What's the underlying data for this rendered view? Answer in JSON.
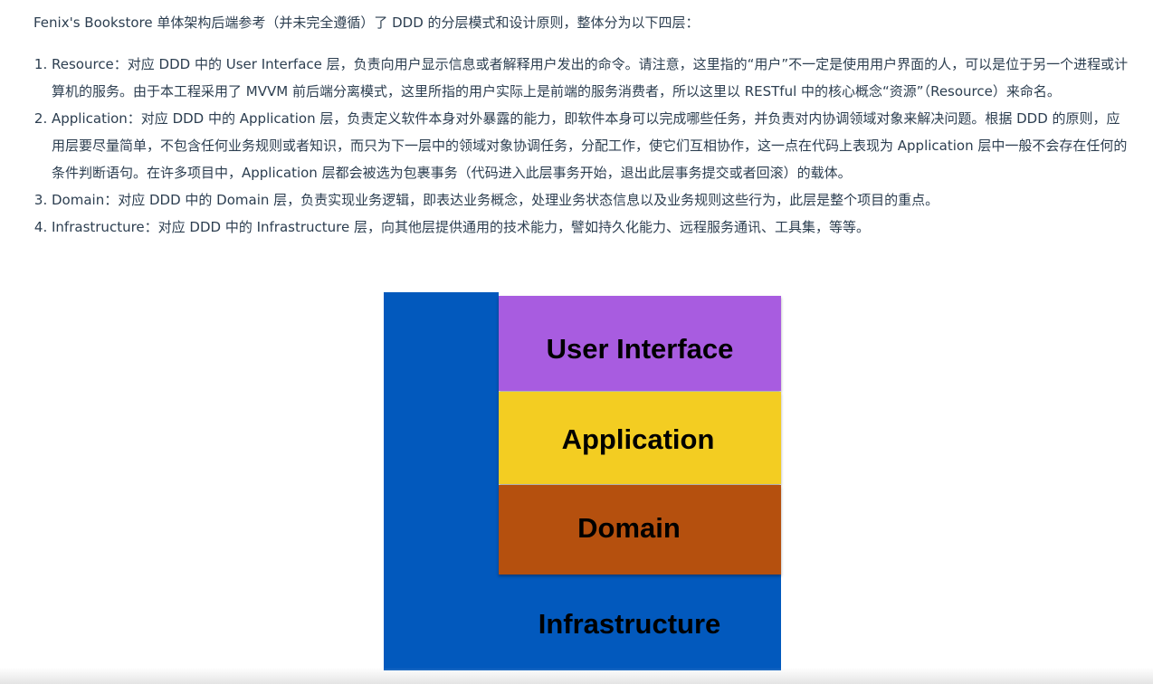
{
  "article": {
    "intro": "Fenix's Bookstore 单体架构后端参考（并未完全遵循）了 DDD 的分层模式和设计原则，整体分为以下四层：",
    "list": [
      "Resource：对应 DDD 中的 User Interface 层，负责向用户显示信息或者解释用户发出的命令。请注意，这里指的“用户”不一定是使用用户界面的人，可以是位于另一个进程或计算机的服务。由于本工程采用了 MVVM 前后端分离模式，这里所指的用户实际上是前端的服务消费者，所以这里以 RESTful 中的核心概念“资源”（Resource）来命名。",
      "Application：对应 DDD 中的 Application 层，负责定义软件本身对外暴露的能力，即软件本身可以完成哪些任务，并负责对内协调领域对象来解决问题。根据 DDD 的原则，应用层要尽量简单，不包含任何业务规则或者知识，而只为下一层中的领域对象协调任务，分配工作，使它们互相协作，这一点在代码上表现为 Application 层中一般不会存在任何的条件判断语句。在许多项目中，Application 层都会被选为包裹事务（代码进入此层事务开始，退出此层事务提交或者回滚）的载体。",
      "Domain：对应 DDD 中的 Domain 层，负责实现业务逻辑，即表达业务概念，处理业务状态信息以及业务规则这些行为，此层是整个项目的重点。",
      "Infrastructure：对应 DDD 中的 Infrastructure 层，向其他层提供通用的技术能力，譬如持久化能力、远程服务通讯、工具集，等等。"
    ]
  },
  "diagram": {
    "layers": {
      "ui": "User Interface",
      "application": "Application",
      "domain": "Domain",
      "infrastructure": "Infrastructure"
    },
    "colors": {
      "ui": "#a85ce0",
      "application": "#f3cd22",
      "domain": "#b5500e",
      "infrastructure": "#0259bd"
    }
  }
}
